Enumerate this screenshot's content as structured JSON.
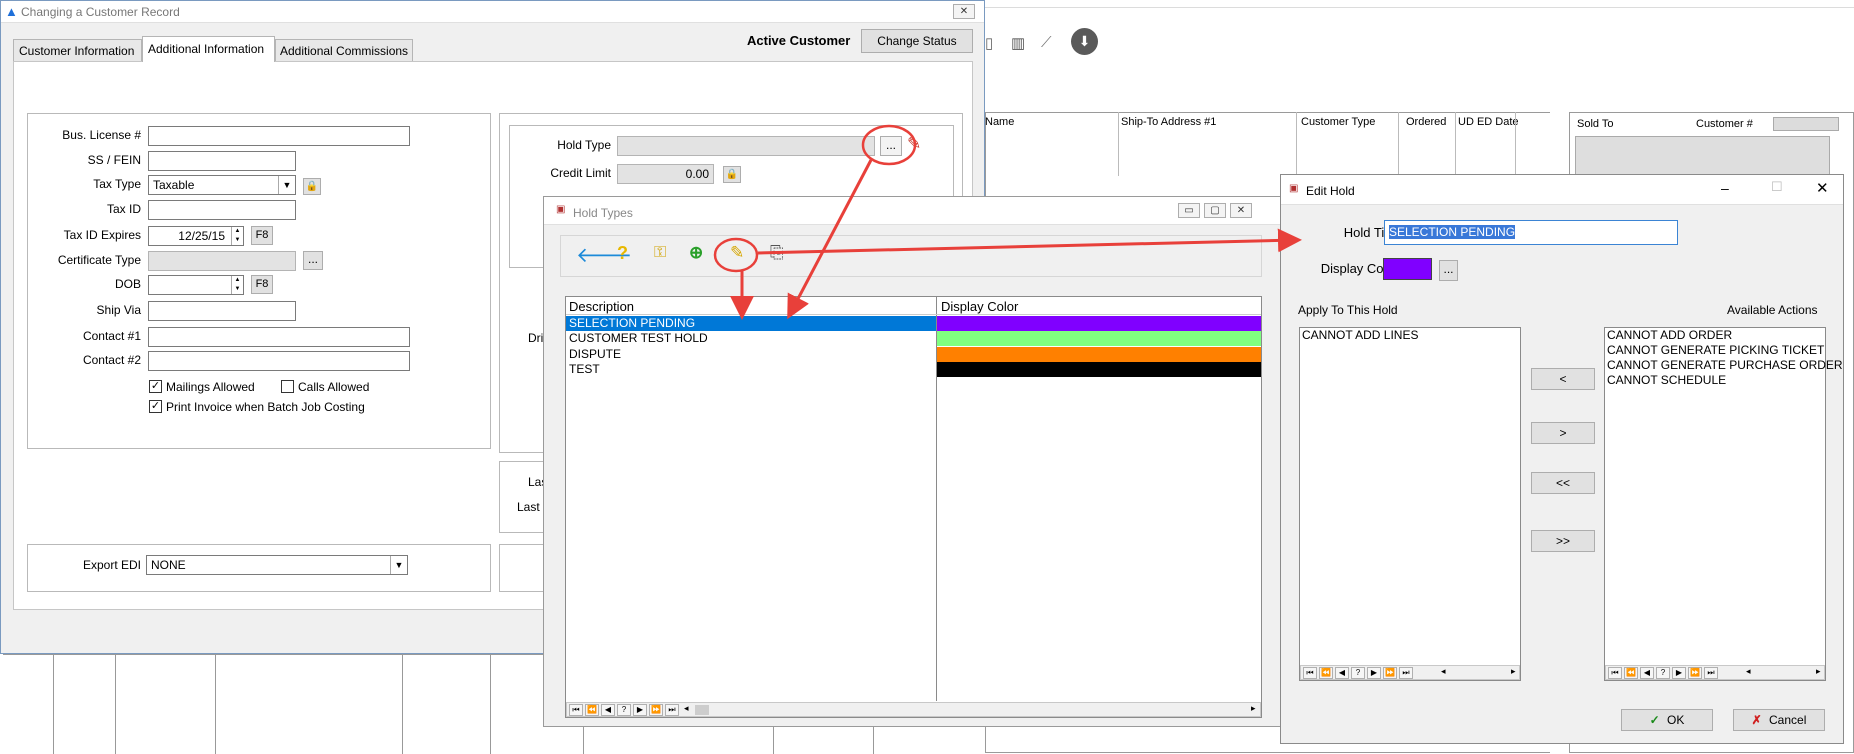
{
  "background_app": {
    "grid_headers": [
      "Name",
      "Ship-To Address #1",
      "Customer Type",
      "Ordered",
      "UD ED Date"
    ],
    "right_panel_headers": [
      "Sold To",
      "Customer #"
    ]
  },
  "customer_window": {
    "title": "Changing a Customer Record",
    "close_label": "✕",
    "tabs": [
      "Customer Information",
      "Additional Information",
      "Additional Commissions"
    ],
    "status_label": "Active Customer",
    "change_status_label": "Change Status",
    "form": {
      "bus_license_label": "Bus. License #",
      "ss_fein_label": "SS / FEIN",
      "tax_type_label": "Tax Type",
      "tax_type_value": "Taxable",
      "tax_id_label": "Tax ID",
      "tax_id_expires_label": "Tax ID Expires",
      "tax_id_expires_value": "12/25/15",
      "f8_label": "F8",
      "certificate_type_label": "Certificate Type",
      "ellipsis": "...",
      "dob_label": "DOB",
      "ship_via_label": "Ship Via",
      "contact1_label": "Contact #1",
      "contact2_label": "Contact #2",
      "mailings_allowed_label": "Mailings Allowed",
      "calls_allowed_label": "Calls Allowed",
      "print_invoice_label": "Print Invoice when Batch Job Costing",
      "export_edi_label": "Export EDI",
      "export_edi_value": "NONE"
    },
    "right_group": {
      "hold_type_label": "Hold Type",
      "credit_limit_label": "Credit Limit",
      "credit_limit_value": "0.00",
      "partial_labels": [
        "Dri",
        "Las",
        "Last D"
      ]
    }
  },
  "hold_types_window": {
    "title": "Hold Types",
    "columns": [
      "Description",
      "Display Color"
    ],
    "rows": [
      {
        "description": "SELECTION PENDING",
        "color": "#8000ff",
        "selected": true
      },
      {
        "description": "CUSTOMER TEST HOLD",
        "color": "#80ff80",
        "selected": false
      },
      {
        "description": "DISPUTE",
        "color": "#ff8000",
        "selected": false
      },
      {
        "description": "TEST",
        "color": "#000000",
        "selected": false
      }
    ]
  },
  "edit_hold_window": {
    "title": "Edit Hold",
    "hold_title_label": "Hold Title",
    "hold_title_value": "SELECTION PENDING",
    "display_color_label": "Display Color",
    "display_color_value": "#8000ff",
    "ellipsis": "...",
    "apply_label": "Apply To This Hold",
    "available_label": "Available Actions",
    "applied_actions": [
      "CANNOT ADD LINES"
    ],
    "available_actions": [
      "CANNOT ADD ORDER",
      "CANNOT GENERATE PICKING TICKET",
      "CANNOT GENERATE PURCHASE ORDER",
      "CANNOT SCHEDULE"
    ],
    "move_buttons": [
      "<",
      ">",
      "<<",
      ">>"
    ],
    "ok_label": "OK",
    "cancel_label": "Cancel"
  },
  "colors": {
    "selection": "#0078d7",
    "annotation": "#e8403a"
  }
}
